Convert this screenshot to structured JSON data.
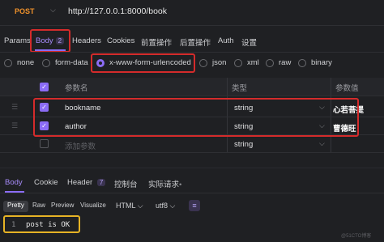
{
  "request": {
    "method": "POST",
    "method_chevron": "⌵",
    "url": "http://127.0.0.1:8000/book"
  },
  "request_tabs": [
    {
      "label": "Params"
    },
    {
      "label": "Body",
      "badge": "2"
    },
    {
      "label": "Headers"
    },
    {
      "label": "Cookies"
    },
    {
      "label": "前置操作"
    },
    {
      "label": "后置操作"
    },
    {
      "label": "Auth"
    },
    {
      "label": "设置"
    }
  ],
  "body_types": [
    {
      "label": "none"
    },
    {
      "label": "form-data"
    },
    {
      "label": "x-www-form-urlencoded",
      "selected": true
    },
    {
      "label": "json"
    },
    {
      "label": "xml"
    },
    {
      "label": "raw"
    },
    {
      "label": "binary"
    }
  ],
  "params_table": {
    "headers": [
      "参数名",
      "类型",
      "参数值"
    ],
    "rows": [
      {
        "name": "bookname",
        "type": "string",
        "value": "心若菩提",
        "checked": true
      },
      {
        "name": "author",
        "type": "string",
        "value": "曹德旺",
        "checked": true
      }
    ],
    "add_row": {
      "placeholder": "添加参数",
      "type": "string"
    }
  },
  "response_tabs": [
    {
      "label": "Body",
      "active": true
    },
    {
      "label": "Cookie"
    },
    {
      "label": "Header",
      "badge": "7"
    },
    {
      "label": "控制台"
    },
    {
      "label": "实际请求",
      "dot": "•"
    }
  ],
  "format_buttons": [
    "Pretty",
    "Raw",
    "Preview",
    "Visualize"
  ],
  "format_selects": {
    "language": "HTML",
    "encoding": "utf8"
  },
  "response_body": {
    "line_number": "1",
    "text": "post is OK"
  },
  "watermark": "@51CTO博客",
  "colors": {
    "accent": "#8b6cf5",
    "method": "#f0922b",
    "highlight_red": "#d42b2b",
    "highlight_yellow": "#e6b325"
  }
}
